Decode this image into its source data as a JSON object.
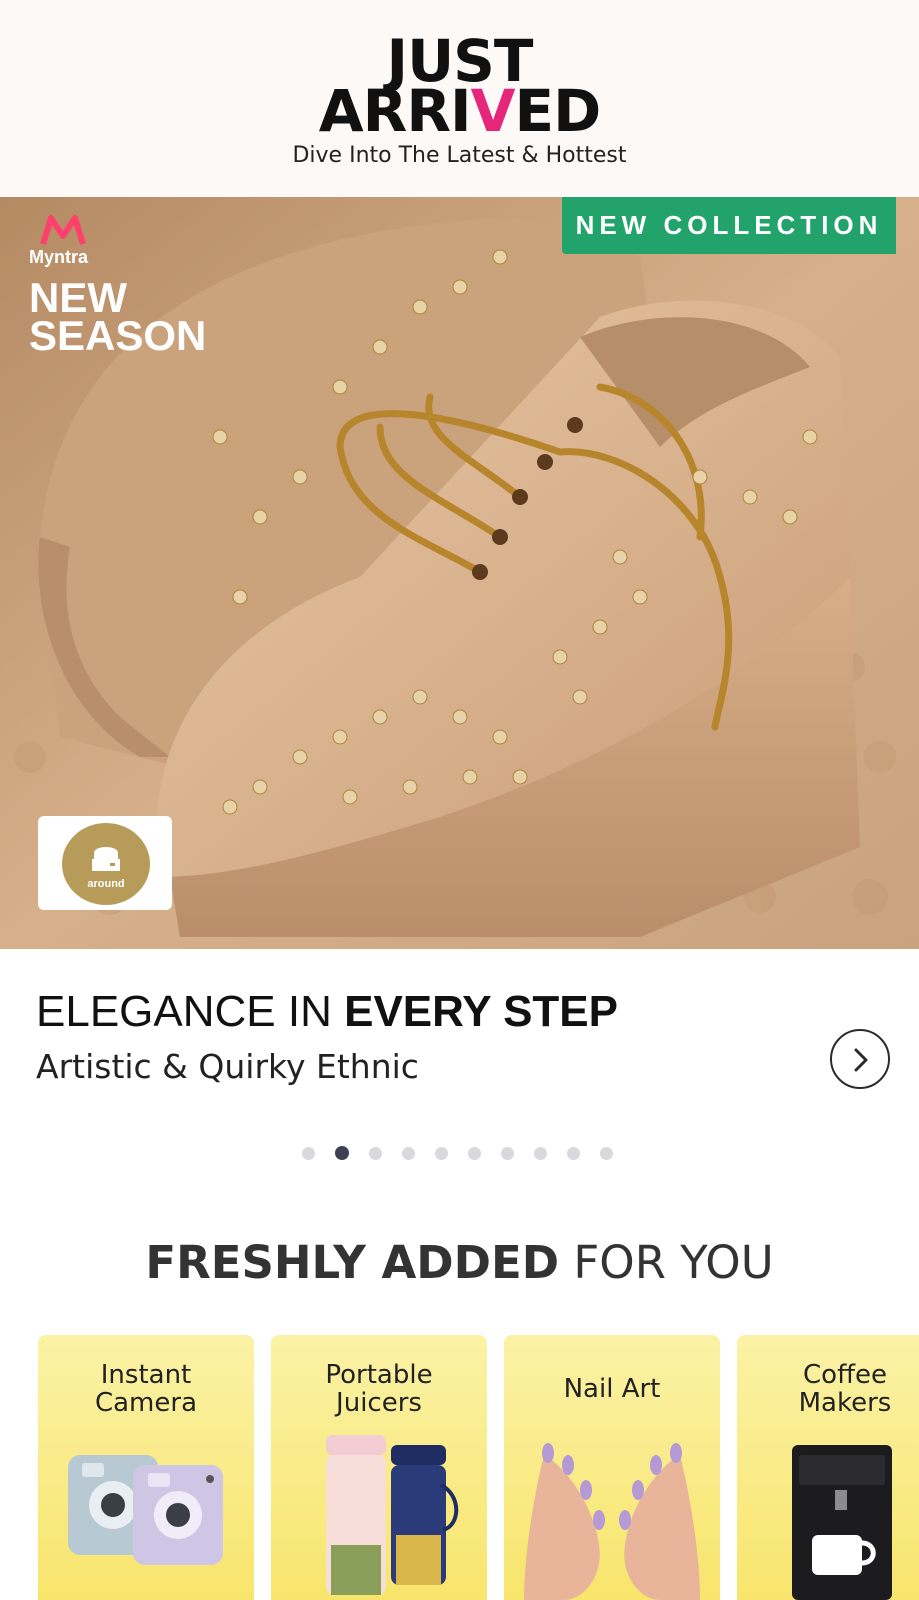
{
  "header": {
    "title_line1": "JUST",
    "title_line2_a": "ARRI",
    "title_line2_accent": "V",
    "title_line2_b": "ED",
    "subtitle": "Dive Into The Latest & Hottest"
  },
  "banner": {
    "brand": "Myntra",
    "season_line1": "NEW",
    "season_line2": "SEASON",
    "tag": "NEW COLLECTION",
    "badge_brand": "around"
  },
  "caption": {
    "title_light": "ELEGANCE IN",
    "title_bold": "EVERY STEP",
    "subtitle": "Artistic & Quirky Ethnic",
    "carousel_dots": 10,
    "active_dot": 2
  },
  "fresh": {
    "title_bold": "FRESHLY ADDED",
    "title_light": "FOR YOU",
    "cards": [
      {
        "label_line1": "Instant",
        "label_line2": "Camera",
        "icon": "instant-camera-icon"
      },
      {
        "label_line1": "Portable",
        "label_line2": "Juicers",
        "icon": "juicer-icon"
      },
      {
        "label_line1": "Nail Art",
        "label_line2": "",
        "icon": "nail-art-icon"
      },
      {
        "label_line1": "Coffee",
        "label_line2": "Makers",
        "icon": "coffee-maker-icon"
      }
    ]
  },
  "colors": {
    "accent_pink": "#e6267a",
    "tag_green": "#22a36b",
    "card_yellow": "#f8e56c",
    "active_dot": "#3d4152"
  }
}
